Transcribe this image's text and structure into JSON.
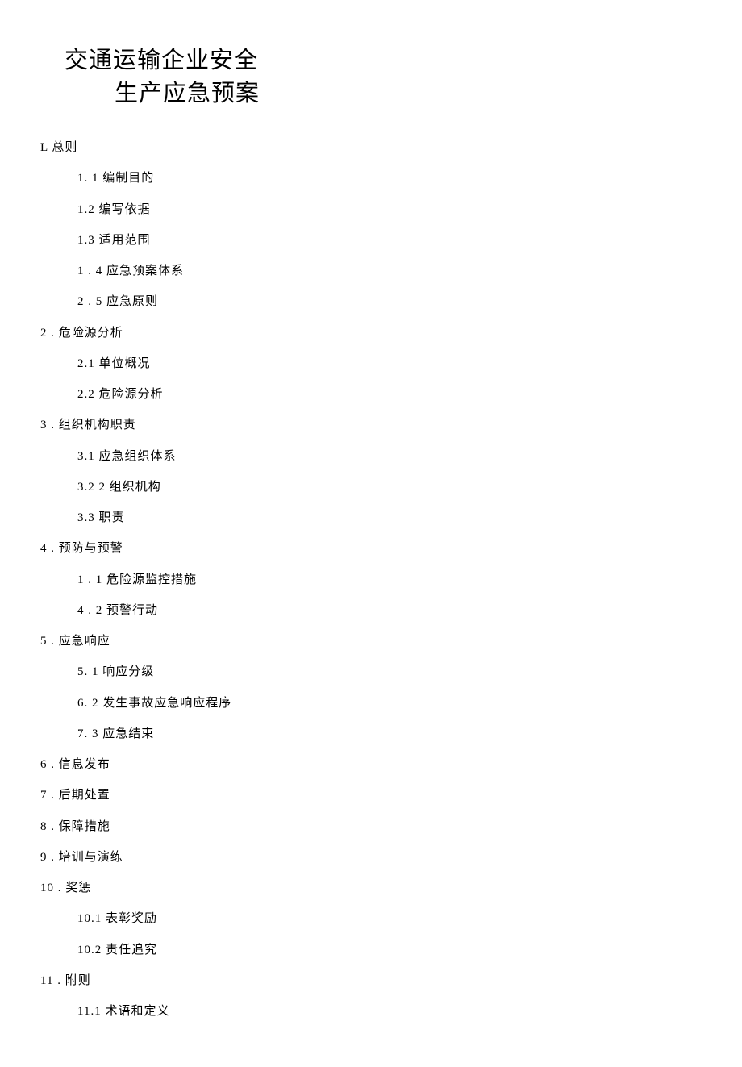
{
  "title": {
    "line1": "交通运输企业安全",
    "line2": "生产应急预案"
  },
  "toc": [
    {
      "level": 1,
      "text": "L 总则"
    },
    {
      "level": 2,
      "text": "1.  1 编制目的"
    },
    {
      "level": 2,
      "text": "1.2  编写依据"
    },
    {
      "level": 2,
      "text": "1.3  适用范围"
    },
    {
      "level": 2,
      "text": "1  . 4 应急预案体系"
    },
    {
      "level": 2,
      "text": "2  . 5 应急原则"
    },
    {
      "level": 1,
      "text": "2  . 危险源分析"
    },
    {
      "level": 2,
      "text": "2.1  单位概况"
    },
    {
      "level": 2,
      "text": "2.2  危险源分析"
    },
    {
      "level": 1,
      "text": "3  . 组织机构职责"
    },
    {
      "level": 2,
      "text": "3.1  应急组织体系"
    },
    {
      "level": 2,
      "text": "3.2 2 组织机构"
    },
    {
      "level": 2,
      "text": "3.3  职责"
    },
    {
      "level": 1,
      "text": "4  . 预防与预警"
    },
    {
      "level": 2,
      "text": "1  . 1 危险源监控措施"
    },
    {
      "level": 2,
      "text": "4  . 2 预警行动"
    },
    {
      "level": 1,
      "text": "5  . 应急响应"
    },
    {
      "level": 2,
      "text": "5.   1 响应分级"
    },
    {
      "level": 2,
      "text": "6.   2 发生事故应急响应程序"
    },
    {
      "level": 2,
      "text": "7.   3 应急结束"
    },
    {
      "level": 1,
      "text": "6  . 信息发布"
    },
    {
      "level": 1,
      "text": "7  . 后期处置"
    },
    {
      "level": 1,
      "text": "8  . 保障措施"
    },
    {
      "level": 1,
      "text": "9  . 培训与演练"
    },
    {
      "level": 1,
      "text": "10  . 奖惩"
    },
    {
      "level": 2,
      "text": "10.1  表彰奖励"
    },
    {
      "level": 2,
      "text": "10.2  责任追究"
    },
    {
      "level": 1,
      "text": "11  . 附则"
    },
    {
      "level": 2,
      "text": "11.1  术语和定义"
    }
  ]
}
